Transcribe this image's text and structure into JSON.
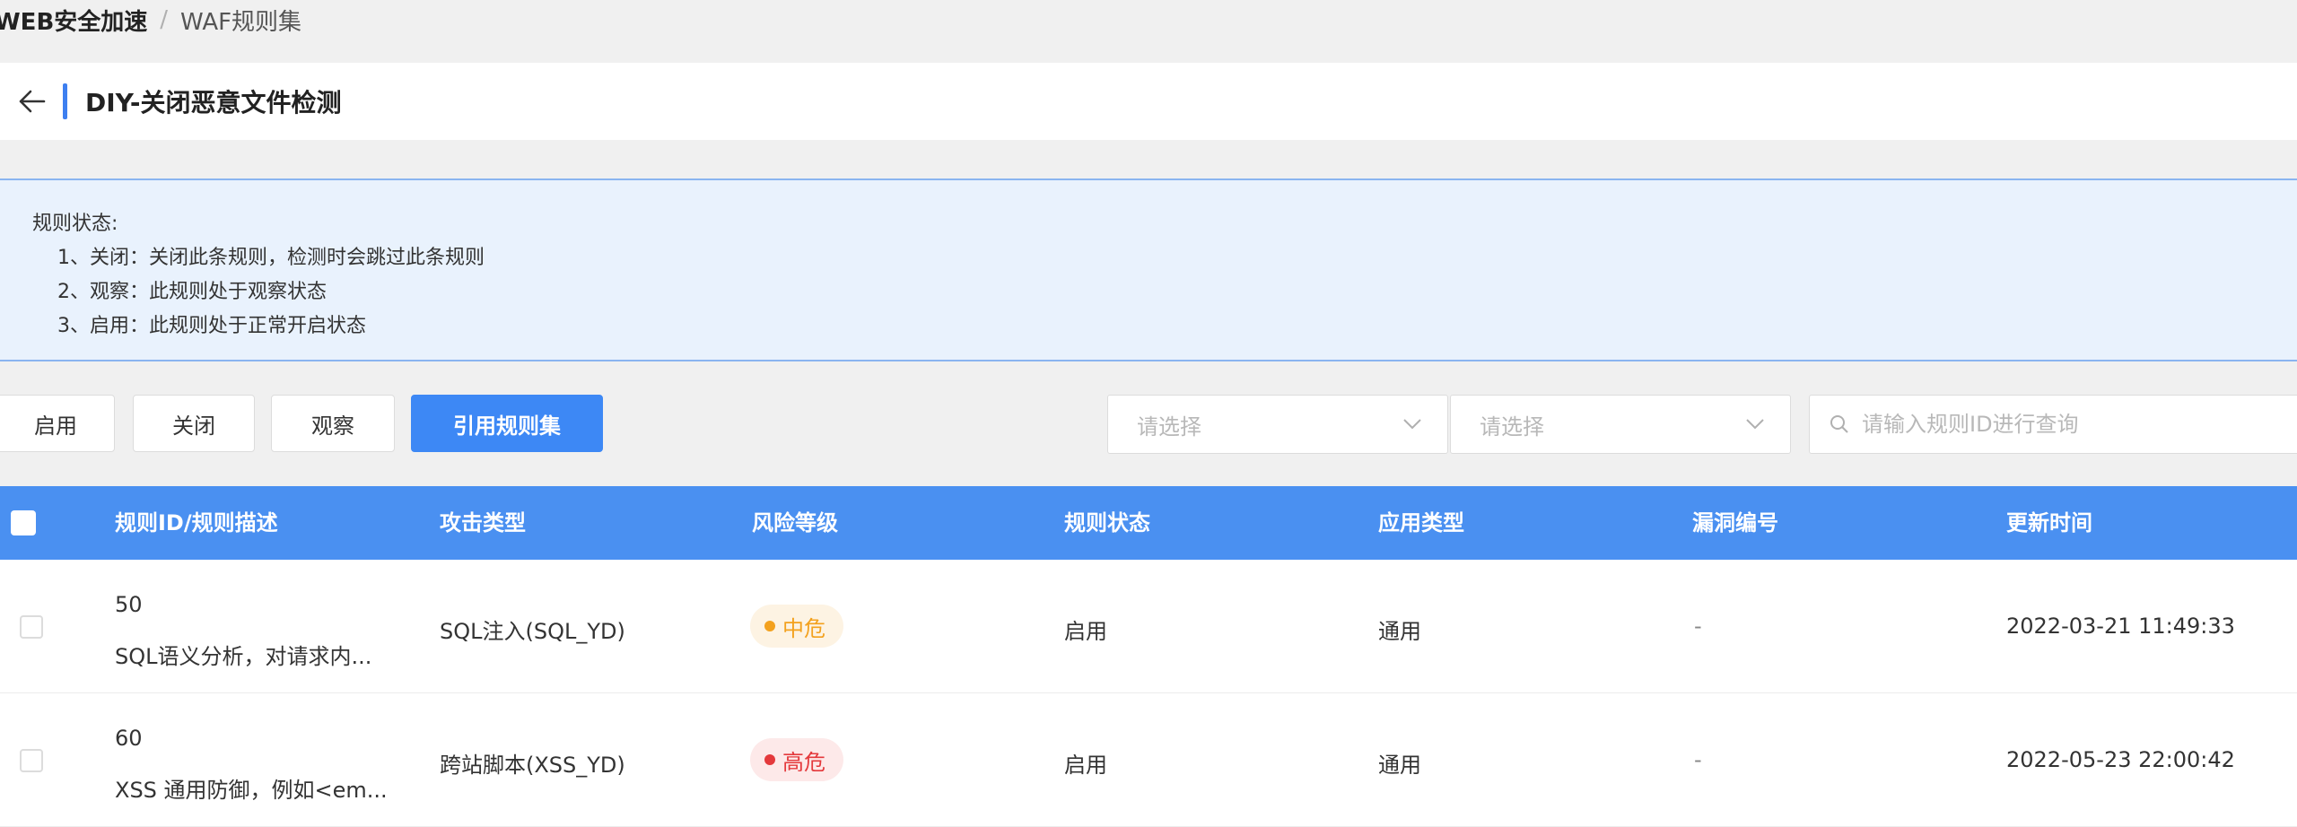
{
  "breadcrumb": {
    "root": "WEB安全加速",
    "separator": "/",
    "current": "WAF规则集"
  },
  "page": {
    "title": "DIY-关闭恶意文件检测",
    "back_icon": "arrow-left-icon"
  },
  "notice": {
    "title": "规则状态:",
    "lines": [
      "1、关闭：关闭此条规则，检测时会跳过此条规则",
      "2、观察：此规则处于观察状态",
      "3、启用：此规则处于正常开启状态"
    ]
  },
  "toolbar": {
    "enable_label": "启用",
    "close_label": "关闭",
    "observe_label": "观察",
    "import_label": "引用规则集",
    "select1_placeholder": "请选择",
    "select2_placeholder": "请选择",
    "search_placeholder": "请输入规则ID进行查询",
    "search_value": ""
  },
  "table": {
    "columns": [
      "规则ID/规则描述",
      "攻击类型",
      "风险等级",
      "规则状态",
      "应用类型",
      "漏洞编号",
      "更新时间"
    ],
    "rows": [
      {
        "id": "50",
        "desc": "SQL语义分析，对请求内...",
        "attack_type": "SQL注入(SQL_YD)",
        "risk": "中危",
        "risk_level": "medium",
        "status": "启用",
        "app_type": "通用",
        "vuln_id": "-",
        "updated": "2022-03-21 11:49:33"
      },
      {
        "id": "60",
        "desc": "XSS 通用防御，例如<em...",
        "attack_type": "跨站脚本(XSS_YD)",
        "risk": "高危",
        "risk_level": "high",
        "status": "启用",
        "app_type": "通用",
        "vuln_id": "-",
        "updated": "2022-05-23 22:00:42"
      }
    ]
  },
  "colors": {
    "accent": "#3d88f5",
    "header_bg": "#4a90f1",
    "medium_risk": "#f3a11e",
    "high_risk": "#e4393c",
    "notice_bg": "#e9f2fd"
  }
}
